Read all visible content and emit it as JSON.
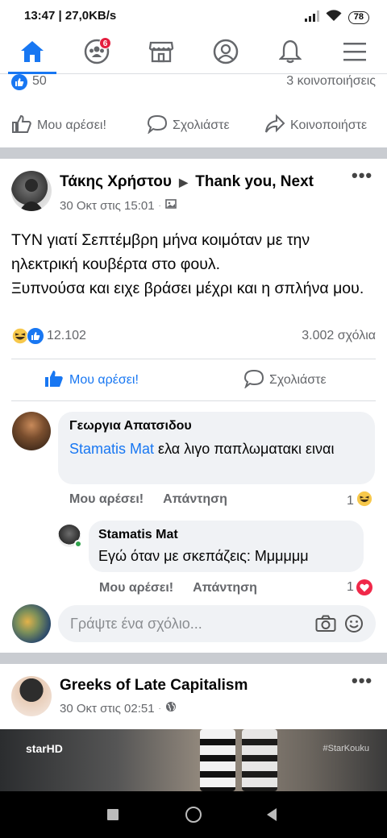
{
  "status_bar": {
    "time_speed": "13:47 | 27,0KB/s",
    "battery": "78"
  },
  "nav": {
    "items": [
      "home-icon",
      "groups-icon",
      "marketplace-icon",
      "profile-icon",
      "notifications-icon",
      "menu-icon"
    ],
    "groups_badge": "6",
    "accent": "#1877f2"
  },
  "prev_post": {
    "likes": "50",
    "shares": "3 κοινοποιήσεις",
    "like_label": "Μου αρέσει!",
    "comment_label": "Σχολιάστε",
    "share_label": "Κοινοποιήστε"
  },
  "post": {
    "author": "Τάκης Χρήστου",
    "group": "Thank you, Next",
    "time": "30 Οκτ στις 15:01",
    "text": "ΤΥΝ γιατί Σεπτέμβρη μήνα κοιμόταν με την ηλεκτρική κουβέρτα στο φουλ.\nΞυπνούσα και ειχε βράσει μέχρι και η σπλήνα μου.",
    "reactions_count": "12.102",
    "comments_count": "3.002 σχόλια",
    "like_label": "Μου αρέσει!",
    "comment_label": "Σχολιάστε"
  },
  "comments": [
    {
      "author": "Γεωργια Απατσιδου",
      "mention": "Stamatis Mat",
      "text": "ελα λιγο παπλωματακι ειναι",
      "like_label": "Μου αρέσει!",
      "reply_label": "Απάντηση",
      "react_count": "1"
    },
    {
      "author": "Stamatis Mat",
      "text": "Εγώ όταν με σκεπάζεις: Μμμμμμ",
      "like_label": "Μου αρέσει!",
      "reply_label": "Απάντηση",
      "react_count": "1"
    }
  ],
  "write_comment": {
    "placeholder": "Γράψτε ένα σχόλιο..."
  },
  "next_post": {
    "author": "Greeks of Late Capitalism",
    "time": "30 Οκτ στις 02:51",
    "video_logo": "starHD",
    "video_tag": "#StarKouku"
  }
}
